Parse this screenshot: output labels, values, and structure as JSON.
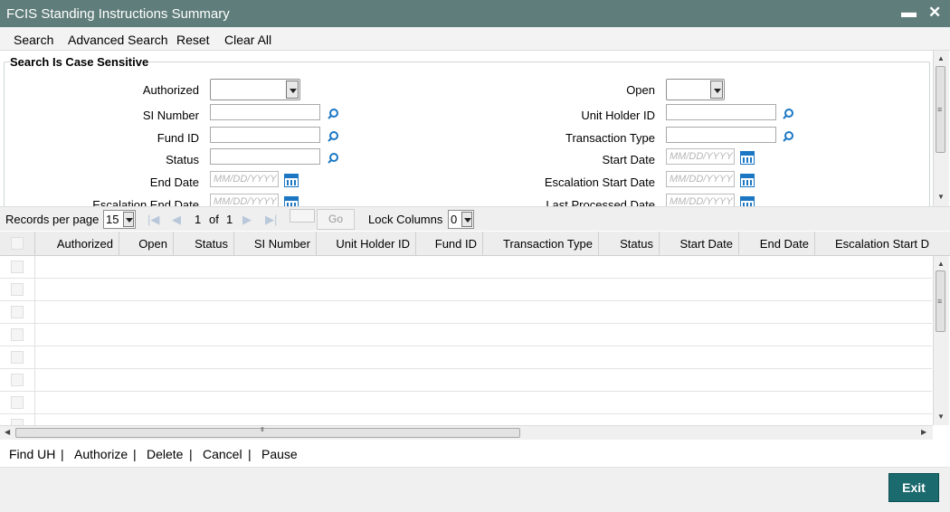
{
  "window": {
    "title": "FCIS Standing Instructions Summary",
    "minimize_glyph": "▬",
    "close_glyph": "✕"
  },
  "toolbar": {
    "search": "Search",
    "advanced_search": "Advanced Search",
    "reset": "Reset",
    "clear_all": "Clear All"
  },
  "search_panel": {
    "legend": "Search Is Case Sensitive",
    "authorized_label": "Authorized",
    "authorized_value": "",
    "open_label": "Open",
    "open_value": "",
    "si_number_label": "SI Number",
    "si_number_value": "",
    "unit_holder_id_label": "Unit Holder ID",
    "unit_holder_id_value": "",
    "fund_id_label": "Fund ID",
    "fund_id_value": "",
    "transaction_type_label": "Transaction Type",
    "transaction_type_value": "",
    "status_label": "Status",
    "status_value": "",
    "start_date_label": "Start Date",
    "end_date_label": "End Date",
    "escalation_start_date_label": "Escalation Start Date",
    "escalation_end_date_label": "Escalation End Date",
    "last_processed_date_label": "Last Processed Date",
    "date_placeholder": "MM/DD/YYYY"
  },
  "pager": {
    "records_per_page_label": "Records per page",
    "records_per_page_value": "15",
    "current_page": "1",
    "of_label": "of",
    "total_pages": "1",
    "go_label": "Go",
    "lock_columns_label": "Lock Columns",
    "lock_columns_value": "0"
  },
  "grid": {
    "columns": [
      "Authorized",
      "Open",
      "Status",
      "SI Number",
      "Unit Holder ID",
      "Fund ID",
      "Transaction Type",
      "Status",
      "Start Date",
      "End Date",
      "Escalation Start D"
    ]
  },
  "footer": {
    "find_uh": "Find UH",
    "authorize": "Authorize",
    "delete": "Delete",
    "cancel": "Cancel",
    "pause": "Pause",
    "separator": "|",
    "exit": "Exit"
  },
  "colors": {
    "titlebar": "#5f7d7a",
    "exit_button": "#1b6a6d",
    "accent_icon": "#1b77c4"
  },
  "icons": [
    "search-lens-icon",
    "calendar-icon",
    "dropdown-arrow-icon",
    "first-page-icon",
    "prev-page-icon",
    "next-page-icon",
    "last-page-icon"
  ]
}
